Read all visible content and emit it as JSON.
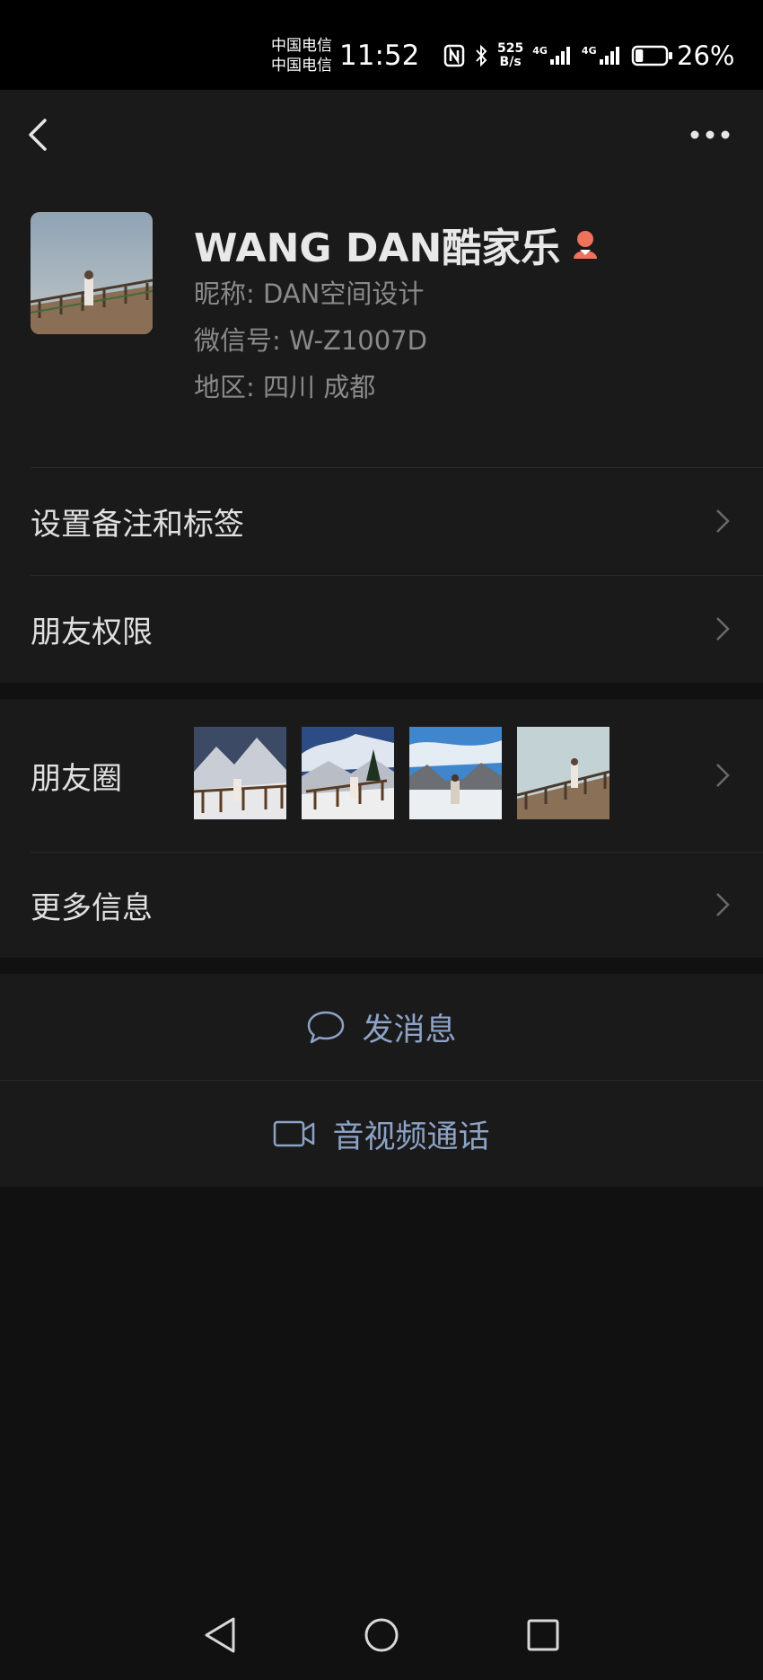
{
  "status_bar": {
    "carrier_1": "中国电信",
    "carrier_2": "中国电信",
    "time": "11:52",
    "net_speed_value": "525",
    "net_speed_unit": "B/s",
    "signal_1_label": "4G",
    "signal_2_label": "4G",
    "battery_percent": "26%",
    "battery_level": 0.26,
    "icons": [
      "nfc-icon",
      "bluetooth-icon",
      "signal-icon",
      "battery-icon"
    ]
  },
  "nav": {
    "back_icon": "chevron-left-icon",
    "more_icon": "more-dots-icon"
  },
  "profile": {
    "display_name": "WANG DAN酷家乐",
    "gender_icon": "female-icon",
    "gender_color": "#f0715c",
    "nickname": "昵称: DAN空间设计",
    "wechat_id": "微信号: W-Z1007D",
    "region": "地区: 四川  成都"
  },
  "menu": {
    "set_remark": "设置备注和标签",
    "friend_permission": "朋友权限",
    "moments": "朋友圈",
    "more_info": "更多信息"
  },
  "actions": {
    "send_message": "发消息",
    "video_call": "音视频通话",
    "accent_color": "#8ca2c6"
  },
  "system_nav": {
    "icons": [
      "back-triangle-icon",
      "home-circle-icon",
      "recents-square-icon"
    ]
  }
}
